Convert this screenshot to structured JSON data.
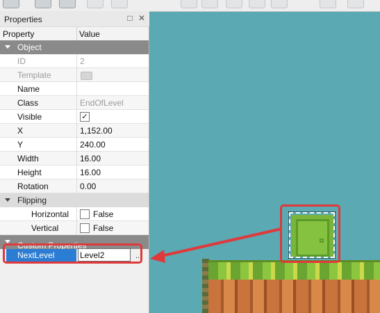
{
  "panel": {
    "title": "Properties",
    "float_icon": "□",
    "close_icon": "✕"
  },
  "columns": {
    "property": "Property",
    "value": "Value"
  },
  "groups": {
    "object": "Object",
    "flipping": "Flipping",
    "custom": "Custom Properties"
  },
  "rows": {
    "id": {
      "name": "ID",
      "value": "2"
    },
    "template": {
      "name": "Template"
    },
    "name": {
      "name": "Name",
      "value": ""
    },
    "class": {
      "name": "Class",
      "value": "EndOfLevel"
    },
    "visible": {
      "name": "Visible",
      "checked": true,
      "check_glyph": "✓"
    },
    "x": {
      "name": "X",
      "value": "1,152.00"
    },
    "y": {
      "name": "Y",
      "value": "240.00"
    },
    "width": {
      "name": "Width",
      "value": "16.00"
    },
    "height": {
      "name": "Height",
      "value": "16.00"
    },
    "rotation": {
      "name": "Rotation",
      "value": "0.00"
    },
    "horizontal": {
      "name": "Horizontal",
      "value": "False"
    },
    "vertical": {
      "name": "Vertical",
      "value": "False"
    },
    "nextlevel": {
      "name": "NextLevel",
      "value": "Level2",
      "more": "..."
    }
  },
  "colors": {
    "highlight": "#e0393b",
    "selection": "#2b7cd3",
    "canvas": "#5aa9b3"
  }
}
